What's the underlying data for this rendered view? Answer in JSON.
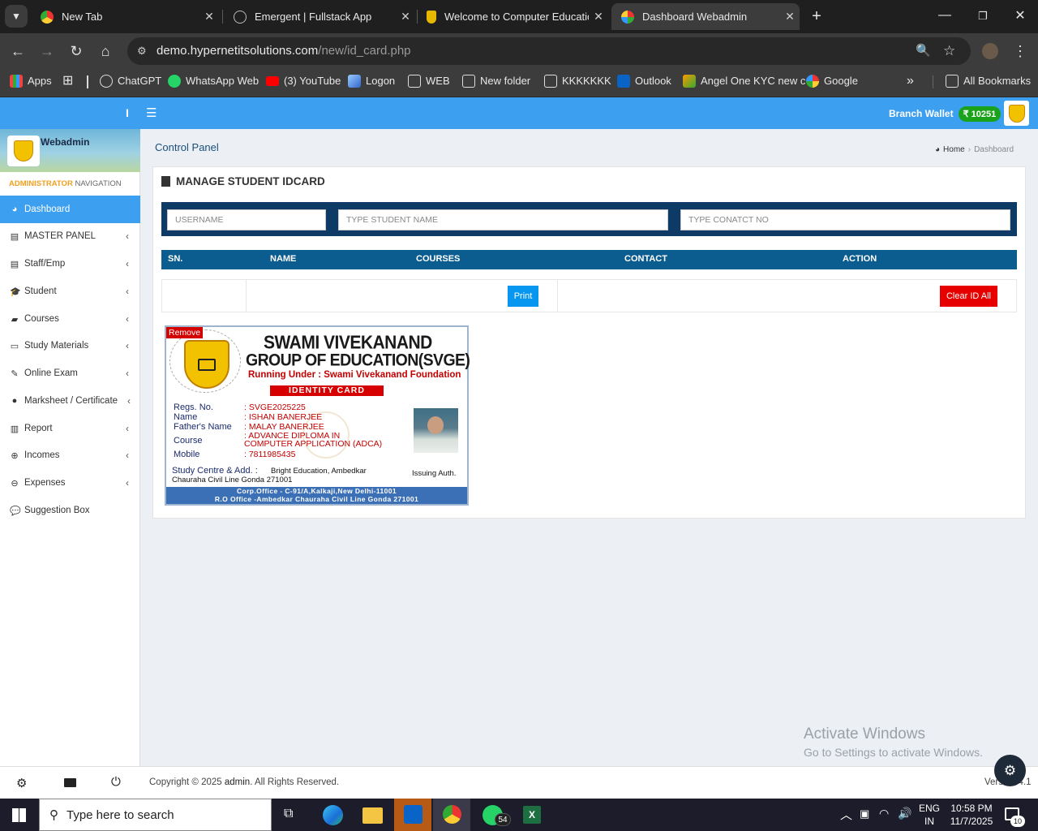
{
  "browser": {
    "tabs": [
      {
        "title": "New Tab"
      },
      {
        "title": "Emergent | Fullstack App"
      },
      {
        "title": "Welcome to Computer Educatio"
      },
      {
        "title": "Dashboard Webadmin"
      }
    ],
    "url_host": "demo.hypernetitsolutions.com",
    "url_path": "/new/id_card.php",
    "bookmarks": [
      "Apps",
      "ChatGPT",
      "WhatsApp Web",
      "(3) YouTube",
      "Logon",
      "WEB",
      "New folder",
      "KKKKKKK",
      "Outlook",
      "Angel One KYC new c",
      "Google"
    ],
    "all_bookmarks": "All Bookmarks"
  },
  "app": {
    "sidebar_toggle": "I",
    "wallet_label": "Branch Wallet",
    "wallet_amount": "₹ 10251",
    "brand": "Webadmin",
    "nav_header_1": "ADMINISTRATOR",
    "nav_header_2": " NAVIGATION",
    "nav": [
      {
        "label": "Dashboard",
        "icon": "dashboard-icon"
      },
      {
        "label": "MASTER PANEL",
        "icon": "file-icon"
      },
      {
        "label": "Staff/Emp",
        "icon": "file-icon"
      },
      {
        "label": "Student",
        "icon": "graduation-cap-icon"
      },
      {
        "label": "Courses",
        "icon": "book-icon"
      },
      {
        "label": "Study Materials",
        "icon": "laptop-icon"
      },
      {
        "label": "Online Exam",
        "icon": "edit-icon"
      },
      {
        "label": "Marksheet / Certificate",
        "icon": "circle-icon"
      },
      {
        "label": "Report",
        "icon": "bar-chart-icon"
      },
      {
        "label": "Incomes",
        "icon": "plus-circle-icon"
      },
      {
        "label": "Expenses",
        "icon": "minus-circle-icon"
      },
      {
        "label": "Suggestion Box",
        "icon": "comments-icon"
      }
    ],
    "page_title": "Control Panel",
    "breadcrumb_home": "Home",
    "breadcrumb_current": "Dashboard",
    "box_title": "MANAGE STUDENT IDCARD",
    "search": {
      "username_placeholder": "USERNAME",
      "name_placeholder": "TYPE STUDENT NAME",
      "contact_placeholder": "TYPE CONATCT NO"
    },
    "table_headers": [
      "SN.",
      "NAME",
      "COURSES",
      "CONTACT",
      "ACTION"
    ],
    "print_label": "Print",
    "clear_label": "Clear ID All",
    "footer_copyright": "Copyright © 2025 ",
    "footer_admin": "admin",
    "footer_rights": ". All Rights Reserved.",
    "footer_version": "Version 4.1"
  },
  "idcard": {
    "remove_label": "Remove",
    "org_line1": "SWAMI VIVEKANAND",
    "org_line2": "GROUP OF EDUCATION(SVGE)",
    "running_under": "Running Under  : Swami Vivekanand Foundation",
    "card_title": "IDENTITY CARD",
    "fields": [
      {
        "label": "Regs. No.",
        "value": ": SVGE2025225"
      },
      {
        "label": "Name",
        "value": ": ISHAN BANERJEE"
      },
      {
        "label": "Father's Name",
        "value": ": MALAY BANERJEE"
      },
      {
        "label": "Course",
        "value": ": ADVANCE DIPLOMA IN COMPUTER APPLICATION (ADCA)"
      },
      {
        "label": "Mobile",
        "value": ": 7811985435"
      }
    ],
    "centre_label": "Study Centre & Add. :",
    "centre_value": "Bright Education, Ambedkar Chauraha Civil Line Gonda 271001",
    "issuing": "Issuing Auth.",
    "corp_office": "Corp.Office - C-91/A,Kalkaji,New Delhi-11001",
    "ro_office": "R.O Office -Ambedkar Chauraha Civil Line Gonda 271001"
  },
  "windows": {
    "activate_title": "Activate Windows",
    "activate_sub": "Go to Settings to activate Windows.",
    "search_placeholder": "Type here to search",
    "lang1": "ENG",
    "lang2": "IN",
    "time": "10:58 PM",
    "date": "11/7/2025",
    "whatsapp_badge": "54",
    "notif_badge": "10"
  },
  "colors": {
    "accent": "#3c9ff0",
    "navy": "#0d3b66",
    "table_header": "#0b5d8f",
    "danger": "#e60000",
    "wallet_badge": "#1aa31a"
  }
}
